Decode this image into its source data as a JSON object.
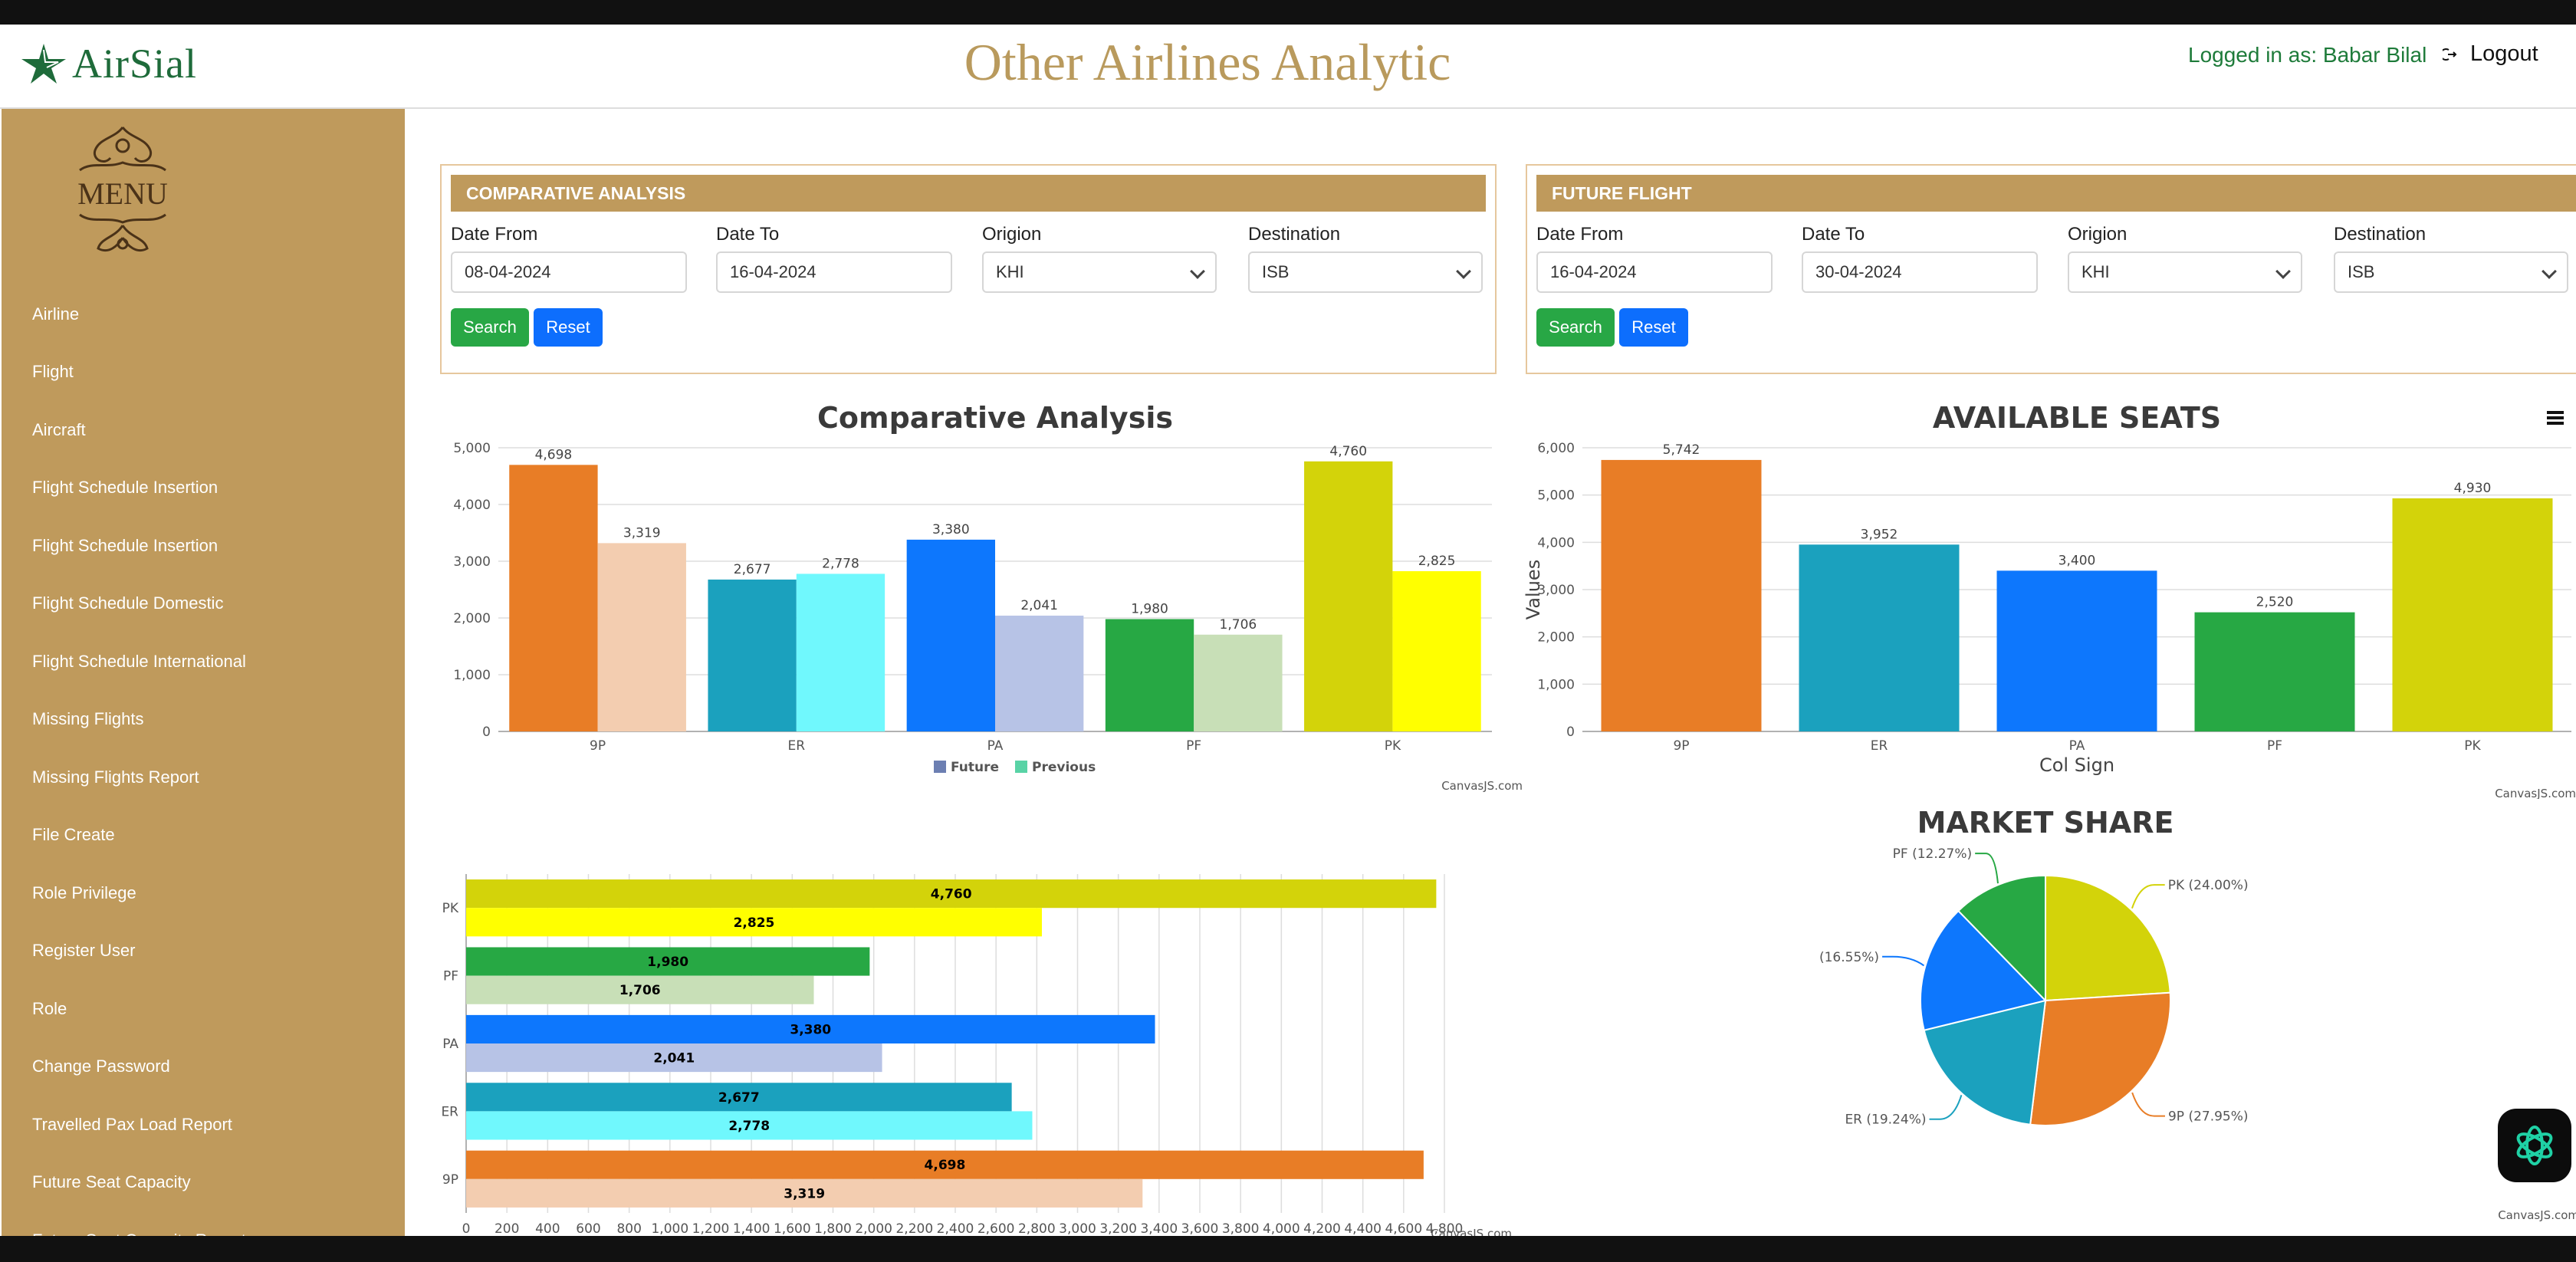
{
  "header": {
    "logo_text": "AirSial",
    "title": "Other Airlines Analytic",
    "user_label": "Logged in as: Babar Bilal",
    "logout_label": "Logout"
  },
  "sidebar": {
    "menu_logo_text": "MENU",
    "items": [
      {
        "label": "Airline"
      },
      {
        "label": "Flight"
      },
      {
        "label": "Aircraft"
      },
      {
        "label": "Flight Schedule Insertion"
      },
      {
        "label": "Flight Schedule Insertion"
      },
      {
        "label": "Flight Schedule Domestic"
      },
      {
        "label": "Flight Schedule International"
      },
      {
        "label": "Missing Flights"
      },
      {
        "label": "Missing Flights Report"
      },
      {
        "label": "File Create"
      },
      {
        "label": "Role Privilege"
      },
      {
        "label": "Register User"
      },
      {
        "label": "Role"
      },
      {
        "label": "Change Password"
      },
      {
        "label": "Travelled Pax Load Report"
      },
      {
        "label": "Future Seat Capacity"
      },
      {
        "label": "Future Seat Capacity Report"
      }
    ]
  },
  "comparative_form": {
    "heading": "COMPARATIVE ANALYSIS",
    "date_from_label": "Date From",
    "date_from": "08-04-2024",
    "date_to_label": "Date To",
    "date_to": "16-04-2024",
    "origin_label": "Origion",
    "origin": "KHI",
    "destination_label": "Destination",
    "destination": "ISB",
    "search_label": "Search",
    "reset_label": "Reset"
  },
  "future_form": {
    "heading": "FUTURE FLIGHT",
    "date_from_label": "Date From",
    "date_from": "16-04-2024",
    "date_to_label": "Date To",
    "date_to": "30-04-2024",
    "origin_label": "Origion",
    "origin": "KHI",
    "destination_label": "Destination",
    "destination": "ISB",
    "search_label": "Search",
    "reset_label": "Reset"
  },
  "colors": {
    "gold": "#bf9a5c",
    "9P": "#e87d26",
    "ER": "#1ba1be",
    "PA": "#0d77fd",
    "PF": "#27a844",
    "PK": "#d3d30a"
  },
  "credit": "CanvasJS.com",
  "chart_data": [
    {
      "type": "bar",
      "title": "Comparative Analysis",
      "categories": [
        "9P",
        "ER",
        "PA",
        "PF",
        "PK"
      ],
      "ylim": [
        0,
        5000
      ],
      "yticks": [
        "0",
        "1,000",
        "2,000",
        "3,000",
        "4,000",
        "5,000"
      ],
      "grid": true,
      "legend_position": "bottom",
      "series": [
        {
          "name": "Future",
          "values": [
            4698,
            2677,
            3380,
            1980,
            4760
          ],
          "labels": [
            "4,698",
            "2,677",
            "3,380",
            "1,980",
            "4,760"
          ],
          "colors": [
            "#e87d26",
            "#1ba1be",
            "#0d77fd",
            "#27a844",
            "#d3d30a"
          ]
        },
        {
          "name": "Previous",
          "values": [
            3319,
            2778,
            2041,
            1706,
            2825
          ],
          "labels": [
            "3,319",
            "2,778",
            "2,041",
            "1,706",
            "2,825"
          ],
          "colors": [
            "#f3cdb0",
            "#70f8fd",
            "#b7c3e6",
            "#c8dfb7",
            "#ffff00"
          ]
        }
      ],
      "legend_swatches": [
        "#6c7fb2",
        "#59d3a6"
      ]
    },
    {
      "type": "bar",
      "title": "AVAILABLE SEATS",
      "xlabel": "Col Sign",
      "ylabel": "Values",
      "categories": [
        "9P",
        "ER",
        "PA",
        "PF",
        "PK"
      ],
      "ylim": [
        0,
        6000
      ],
      "yticks": [
        "0",
        "1,000",
        "2,000",
        "3,000",
        "4,000",
        "5,000",
        "6,000"
      ],
      "grid": true,
      "values": [
        5742,
        3952,
        3400,
        2520,
        4930
      ],
      "labels": [
        "5,742",
        "3,952",
        "3,400",
        "2,520",
        "4,930"
      ]
    },
    {
      "type": "bar",
      "orientation": "horizontal",
      "categories": [
        "PK",
        "PF",
        "PA",
        "ER",
        "9P"
      ],
      "xlim": [
        0,
        4800
      ],
      "xticks": [
        "0",
        "200",
        "400",
        "600",
        "800",
        "1,000",
        "1,200",
        "1,400",
        "1,600",
        "1,800",
        "2,000",
        "2,200",
        "2,400",
        "2,600",
        "2,800",
        "3,000",
        "3,200",
        "3,400",
        "3,600",
        "3,800",
        "4,000",
        "4,200",
        "4,400",
        "4,600",
        "4,800"
      ],
      "grid": true,
      "series": [
        {
          "values": [
            4760,
            1980,
            3380,
            2677,
            4698
          ],
          "labels": [
            "4,760",
            "1,980",
            "3,380",
            "2,677",
            "4,698"
          ],
          "colors": [
            "#d3d30a",
            "#27a844",
            "#0d77fd",
            "#1ba1be",
            "#e87d26"
          ]
        },
        {
          "values": [
            2825,
            1706,
            2041,
            2778,
            3319
          ],
          "labels": [
            "2,825",
            "1,706",
            "2,041",
            "2,778",
            "3,319"
          ],
          "colors": [
            "#ffff00",
            "#c8dfb7",
            "#b7c3e6",
            "#70f8fd",
            "#f3cdb0"
          ]
        }
      ]
    },
    {
      "type": "pie",
      "title": "MARKET SHARE",
      "slices": [
        {
          "name": "PK",
          "value": 24.0,
          "label": "PK (24.00%)",
          "color": "#d3d30a"
        },
        {
          "name": "9P",
          "value": 27.95,
          "label": "9P (27.95%)",
          "color": "#e87d26"
        },
        {
          "name": "ER",
          "value": 19.24,
          "label": "ER (19.24%)",
          "color": "#1ba1be"
        },
        {
          "name": "PA",
          "value": 16.55,
          "label": "PA (16.55%)",
          "color": "#0d77fd"
        },
        {
          "name": "PF",
          "value": 12.27,
          "label": "PF (12.27%)",
          "color": "#27a844"
        }
      ]
    }
  ]
}
